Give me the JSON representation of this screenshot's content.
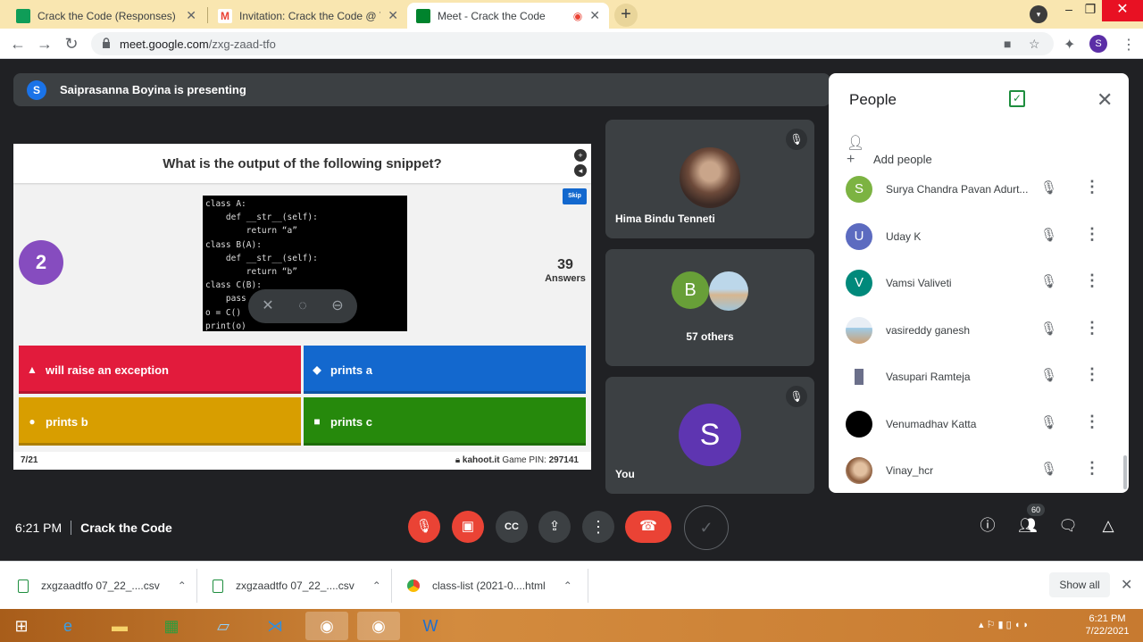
{
  "browser": {
    "tabs": [
      {
        "title": "Crack the Code (Responses) - Go",
        "color": "#0f9d58"
      },
      {
        "title": "Invitation: Crack the Code @ Thu",
        "color": "#ea4335"
      },
      {
        "title": "Meet - Crack the Code",
        "color": "#00832d",
        "active": true
      }
    ],
    "url_host": "meet.google.com",
    "url_path": "/zxg-zaad-tfo",
    "profile_letter": "S"
  },
  "meet": {
    "presenter_avatar": "S",
    "presenting_text": "Saiprasanna Boyina is presenting",
    "slide": {
      "question": "What is the output of the following snippet?",
      "code_lines": [
        "class A:",
        "    def __str__(self):",
        "        return “a”",
        "class B(A):",
        "    def __str__(self):",
        "        return “b”",
        "class C(B):",
        "    pass",
        "o = C()",
        "print(o)"
      ],
      "question_number": "2",
      "skip_label": "Skip",
      "answers_count": "39",
      "answers_label": "Answers",
      "options": [
        {
          "shape": "▲",
          "text": "will raise an exception",
          "color": "red"
        },
        {
          "shape": "◆",
          "text": "prints a",
          "color": "blue"
        },
        {
          "shape": "●",
          "text": "prints b",
          "color": "yellow"
        },
        {
          "shape": "■",
          "text": "prints c",
          "color": "green"
        }
      ],
      "progress": "7/21",
      "site": "kahoot.it",
      "pin_label": "Game PIN:",
      "pin": "297141"
    },
    "tiles": [
      {
        "name": "Hima Bindu Tenneti"
      },
      {
        "name": "57 others",
        "avatar_letter": "B"
      },
      {
        "name": "You",
        "avatar_letter": "S"
      }
    ],
    "meeting_time": "6:21 PM",
    "meeting_name": "Crack the Code",
    "participant_count": "60"
  },
  "people": {
    "title": "People",
    "add_people": "Add people",
    "list": [
      {
        "name": "Surya Chandra Pavan Adurt...",
        "letter": "S",
        "color": "#7cb342"
      },
      {
        "name": "Uday K",
        "letter": "U",
        "color": "#5c6bc0"
      },
      {
        "name": "Vamsi Valiveti",
        "letter": "V",
        "color": "#00897b"
      },
      {
        "name": "vasireddy ganesh",
        "letter": "",
        "color": "#9ecbe8"
      },
      {
        "name": "Vasupari Ramteja",
        "letter": "",
        "color": "#6b6f8a"
      },
      {
        "name": "Venumadhav Katta",
        "letter": "",
        "color": "#000000"
      },
      {
        "name": "Vinay_hcr",
        "letter": "",
        "color": "#c8a080"
      }
    ]
  },
  "downloads": [
    {
      "name": "zxgzaadtfo 07_22_....csv"
    },
    {
      "name": "zxgzaadtfo 07_22_....csv"
    },
    {
      "name": "class-list (2021-0....html"
    }
  ],
  "show_all": "Show all",
  "taskbar": {
    "time": "6:21 PM",
    "date": "7/22/2021"
  }
}
